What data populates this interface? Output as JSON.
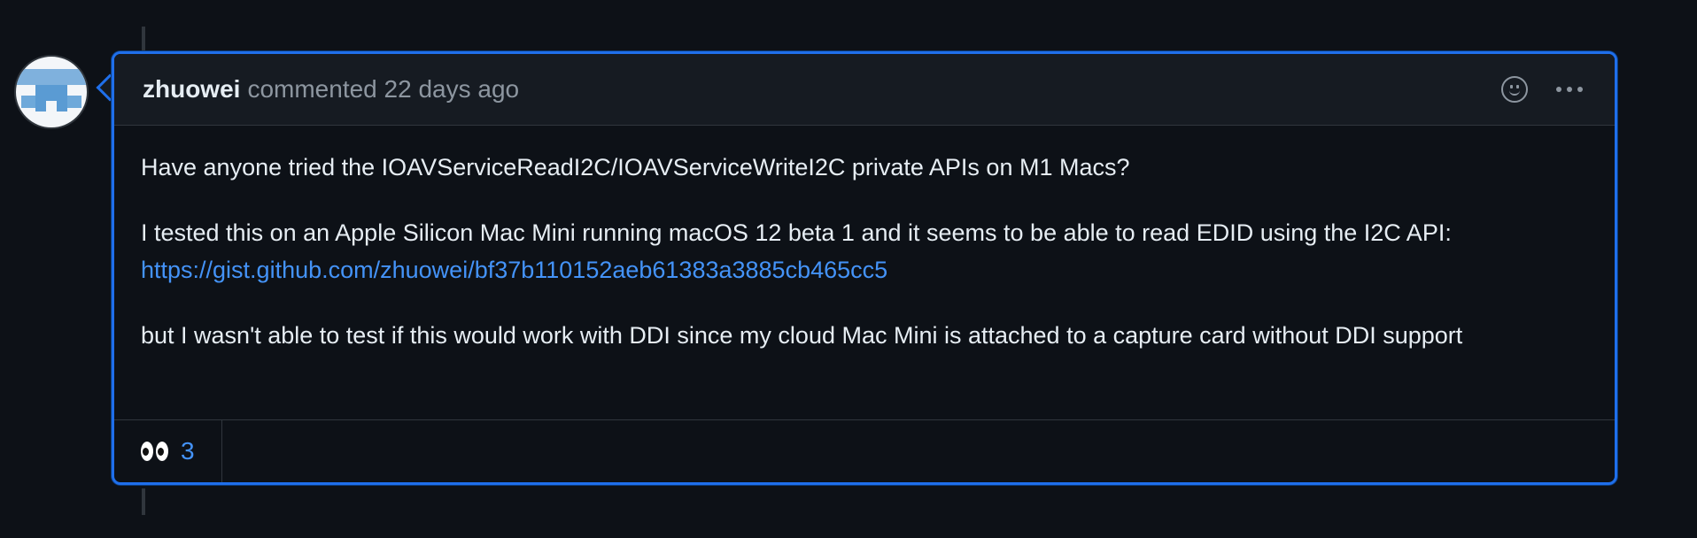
{
  "comment": {
    "author": "zhuowei",
    "meta": "commented 22 days ago",
    "paragraphs": {
      "p1": "Have anyone tried the IOAVServiceReadI2C/IOAVServiceWriteI2C private APIs on M1 Macs?",
      "p2_text": "I tested this on an Apple Silicon Mac Mini running macOS 12 beta 1 and it seems to be able to read EDID using the I2C API:",
      "p2_link": "https://gist.github.com/zhuowei/bf37b110152aeb61383a3885cb465cc5",
      "p3": "but I wasn't able to test if this would work with DDI since my cloud Mac Mini is attached to a capture card without DDI support"
    },
    "reactions": [
      {
        "icon": "eyes-icon",
        "count": "3"
      }
    ],
    "colors": {
      "accent_border": "#1f6feb",
      "link": "#4493f8",
      "background": "#0d1117"
    }
  }
}
